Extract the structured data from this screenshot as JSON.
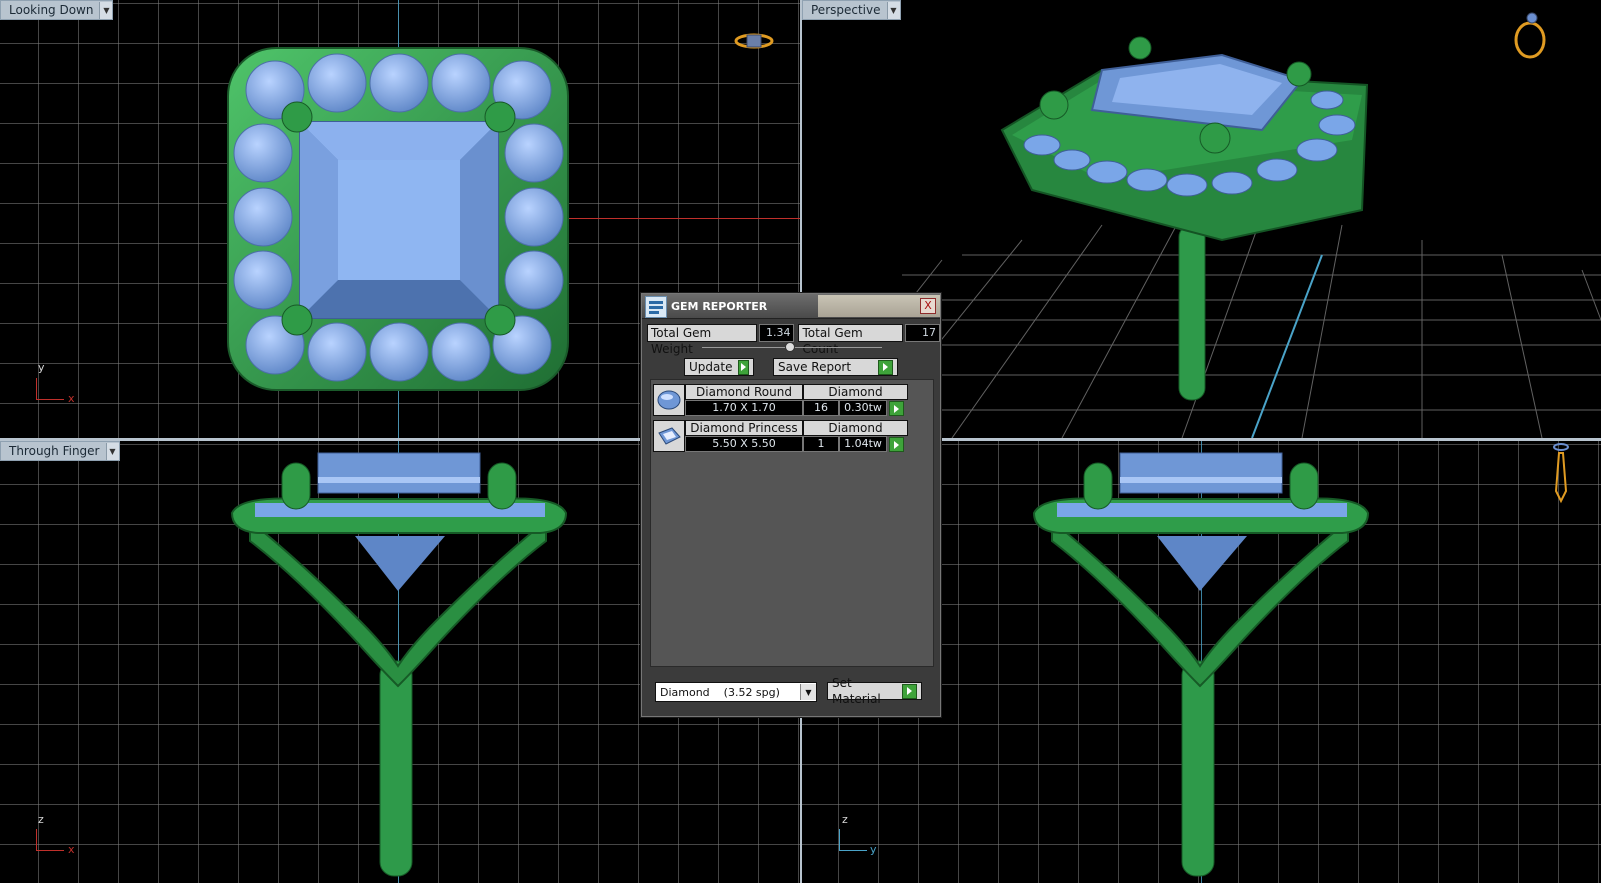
{
  "viewports": {
    "top_left": {
      "label": "Looking Down",
      "axis_v": "y",
      "axis_h": "x"
    },
    "top_right": {
      "label": "Perspective"
    },
    "bottom_left": {
      "label": "Through Finger",
      "axis_v": "z",
      "axis_h": "x"
    },
    "bottom_right": {
      "axis_v": "z",
      "axis_h": "y"
    }
  },
  "gem_reporter": {
    "title": "GEM REPORTER",
    "close": "X",
    "total_weight_label": "Total Gem Weight",
    "total_weight_value": "1.34",
    "total_count_label": "Total Gem Count",
    "total_count_value": "17",
    "update_label": "Update",
    "save_report_label": "Save Report",
    "gems": [
      {
        "shape": "Diamond Round",
        "material": "Diamond",
        "size": "1.70 X 1.70",
        "count": "16",
        "weight": "0.30tw",
        "icon": "round-gem-icon"
      },
      {
        "shape": "Diamond Princess",
        "material": "Diamond",
        "size": "5.50 X 5.50",
        "count": "1",
        "weight": "1.04tw",
        "icon": "princess-gem-icon"
      }
    ],
    "material_select": "Diamond    (3.52 spg)",
    "set_material_label": "Set Material"
  },
  "colors": {
    "metal": "#2e9a4a",
    "gem": "#7aa6e8",
    "accent_go": "#3ea33a"
  }
}
